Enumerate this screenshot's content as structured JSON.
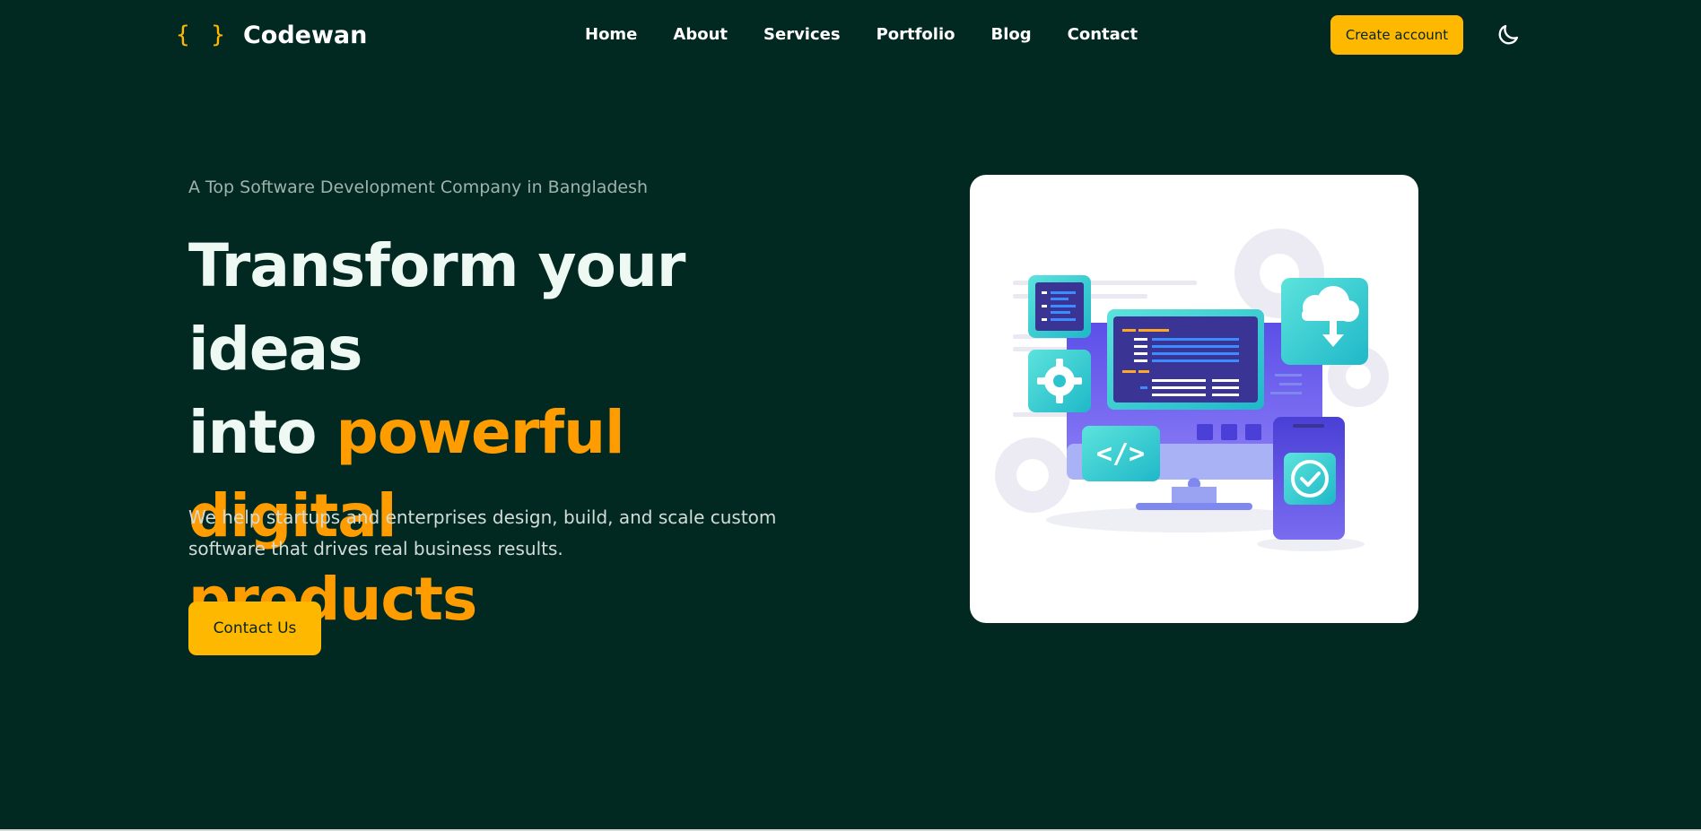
{
  "brand": {
    "mark": "{ }",
    "name": "Codewan",
    "accent": "#ffb800",
    "highlight": "#ff9d00",
    "background": "#012921"
  },
  "nav": {
    "items": [
      {
        "label": "Home"
      },
      {
        "label": "About"
      },
      {
        "label": "Services"
      },
      {
        "label": "Portfolio"
      },
      {
        "label": "Blog"
      },
      {
        "label": "Contact"
      }
    ]
  },
  "header": {
    "create_account_label": "Create account",
    "theme_icon": "moon-icon"
  },
  "hero": {
    "eyebrow": "A Top Software Development Company in Bangladesh",
    "headline_line1": "Transform your ideas",
    "headline_into": "into ",
    "headline_highlight1": "powerful digital",
    "headline_highlight2": "products",
    "description": "We help startups and enterprises design, build, and scale custom software that drives real business results.",
    "cta_label": "Contact Us",
    "illustration": "software-development-illustration"
  }
}
